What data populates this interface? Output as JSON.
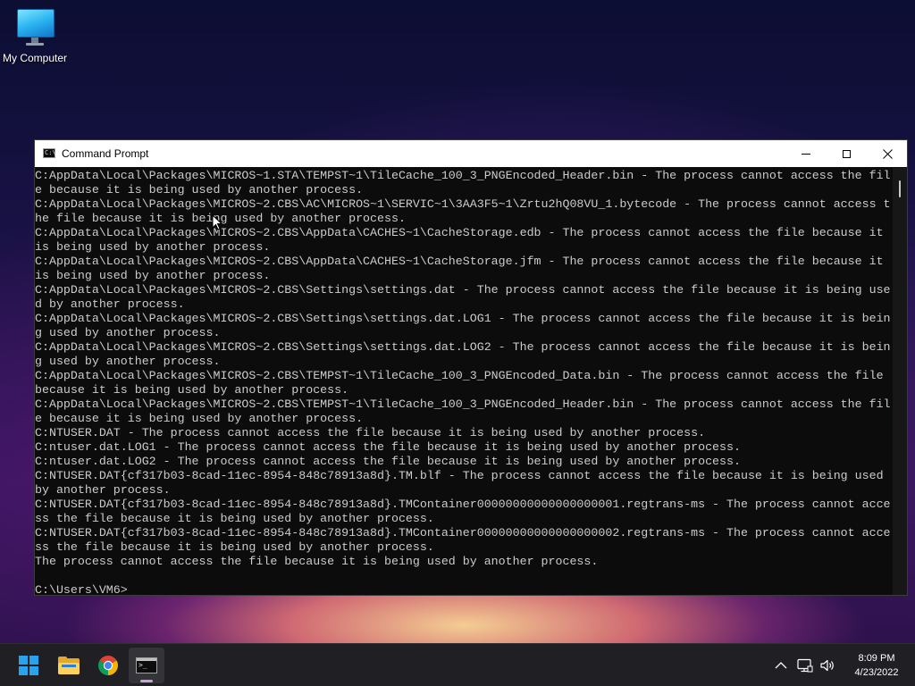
{
  "desktop": {
    "icons": [
      {
        "label": "My Computer",
        "icon": "computer-icon"
      }
    ]
  },
  "window": {
    "title": "Command Prompt",
    "app_icon": "cmd-icon",
    "controls": [
      "minimize",
      "maximize",
      "close"
    ],
    "console": {
      "text_color": "#cccccc",
      "background": "#0c0c0c",
      "lines": [
        "C:AppData\\Local\\Packages\\MICROS~1.STA\\TEMPST~1\\TileCache_100_3_PNGEncoded_Header.bin - The process cannot access the fil",
        "e because it is being used by another process.",
        "C:AppData\\Local\\Packages\\MICROS~2.CBS\\AC\\MICROS~1\\SERVIC~1\\3AA3F5~1\\Zrtu2hQ08VU_1.bytecode - The process cannot access t",
        "he file because it is being used by another process.",
        "C:AppData\\Local\\Packages\\MICROS~2.CBS\\AppData\\CACHES~1\\CacheStorage.edb - The process cannot access the file because it",
        "is being used by another process.",
        "C:AppData\\Local\\Packages\\MICROS~2.CBS\\AppData\\CACHES~1\\CacheStorage.jfm - The process cannot access the file because it",
        "is being used by another process.",
        "C:AppData\\Local\\Packages\\MICROS~2.CBS\\Settings\\settings.dat - The process cannot access the file because it is being use",
        "d by another process.",
        "C:AppData\\Local\\Packages\\MICROS~2.CBS\\Settings\\settings.dat.LOG1 - The process cannot access the file because it is bein",
        "g used by another process.",
        "C:AppData\\Local\\Packages\\MICROS~2.CBS\\Settings\\settings.dat.LOG2 - The process cannot access the file because it is bein",
        "g used by another process.",
        "C:AppData\\Local\\Packages\\MICROS~2.CBS\\TEMPST~1\\TileCache_100_3_PNGEncoded_Data.bin - The process cannot access the file",
        "because it is being used by another process.",
        "C:AppData\\Local\\Packages\\MICROS~2.CBS\\TEMPST~1\\TileCache_100_3_PNGEncoded_Header.bin - The process cannot access the fil",
        "e because it is being used by another process.",
        "C:NTUSER.DAT - The process cannot access the file because it is being used by another process.",
        "C:ntuser.dat.LOG1 - The process cannot access the file because it is being used by another process.",
        "C:ntuser.dat.LOG2 - The process cannot access the file because it is being used by another process.",
        "C:NTUSER.DAT{cf317b03-8cad-11ec-8954-848c78913a8d}.TM.blf - The process cannot access the file because it is being used",
        "by another process.",
        "C:NTUSER.DAT{cf317b03-8cad-11ec-8954-848c78913a8d}.TMContainer00000000000000000001.regtrans-ms - The process cannot acce",
        "ss the file because it is being used by another process.",
        "C:NTUSER.DAT{cf317b03-8cad-11ec-8954-848c78913a8d}.TMContainer00000000000000000002.regtrans-ms - The process cannot acce",
        "ss the file because it is being used by another process.",
        "The process cannot access the file because it is being used by another process.",
        "",
        "C:\\Users\\VM6>"
      ]
    },
    "scrollbar": {
      "position": 0.03,
      "visible_fraction": 0.04
    }
  },
  "taskbar": {
    "items": [
      {
        "name": "start",
        "icon": "windows-logo-icon"
      },
      {
        "name": "file-explorer",
        "icon": "folder-icon"
      },
      {
        "name": "chrome",
        "icon": "chrome-icon"
      },
      {
        "name": "command-prompt",
        "icon": "cmd-icon",
        "active": true
      }
    ],
    "tray": {
      "icons": [
        "chevron-up-icon",
        "network-icon",
        "volume-icon"
      ],
      "time": "8:09 PM",
      "date": "4/23/2022"
    }
  },
  "colors": {
    "start_blue": "#2aa3ee",
    "active_indicator": "#c9a3dd"
  }
}
